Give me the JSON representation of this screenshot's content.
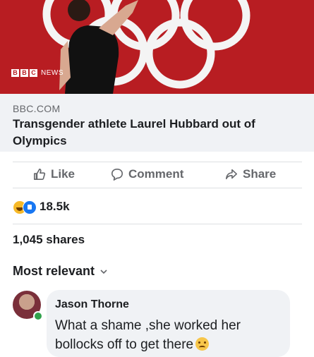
{
  "post": {
    "image": {
      "badge_letters": [
        "B",
        "B",
        "C"
      ],
      "badge_text": "NEWS",
      "colors": {
        "background": "#b81d22",
        "rings": "#f4f4f4"
      }
    },
    "link": {
      "domain": "BBC.COM",
      "title": "Transgender athlete Laurel Hubbard out of Olympics"
    },
    "actions": [
      {
        "label": "Like",
        "icon": "thumbs-up-icon"
      },
      {
        "label": "Comment",
        "icon": "comment-bubble-icon"
      },
      {
        "label": "Share",
        "icon": "share-arrow-icon"
      }
    ],
    "reactions": {
      "icons": [
        "haha-icon",
        "like-icon"
      ],
      "count": "18.5k"
    },
    "shares": "1,045 shares"
  },
  "comments": {
    "sort_label": "Most relevant",
    "items": [
      {
        "author": "Jason Thorne",
        "text": "What a shame ,she worked her bollocks off to get there",
        "emoji": "confused-face-emoji",
        "online": true
      }
    ]
  }
}
